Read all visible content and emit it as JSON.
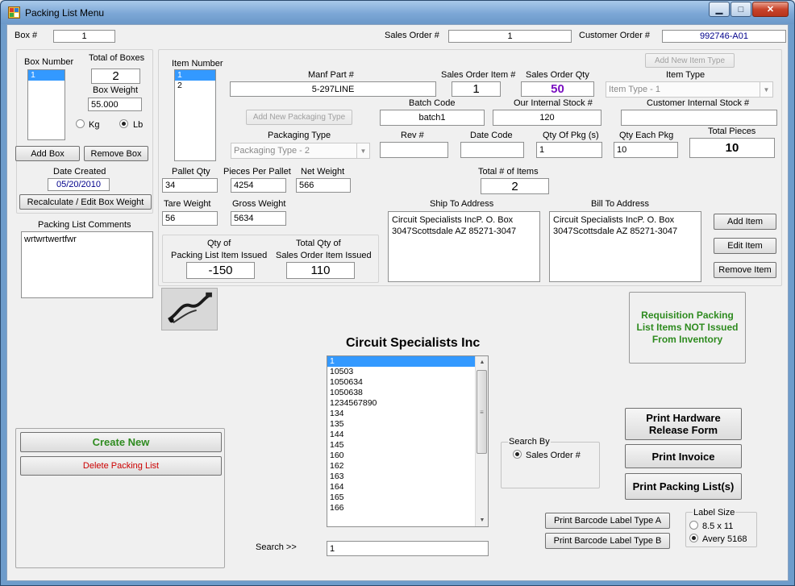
{
  "window": {
    "title": "Packing List Menu",
    "min_glyph": "▁",
    "max_glyph": "□",
    "close_glyph": "✕"
  },
  "header": {
    "box_label": "Box #",
    "box_value": "1",
    "sales_order_label": "Sales Order #",
    "sales_order_value": "1",
    "customer_order_label": "Customer Order #",
    "customer_order_value": "992746-A01"
  },
  "box_panel": {
    "box_number_label": "Box Number",
    "box_numbers": [
      "1"
    ],
    "total_boxes_label": "Total of Boxes",
    "total_boxes_value": "2",
    "box_weight_label": "Box Weight",
    "box_weight_value": "55.000",
    "kg_label": "Kg",
    "lb_label": "Lb",
    "unit_selected": "Lb",
    "add_box": "Add Box",
    "remove_box": "Remove Box",
    "date_created_label": "Date Created",
    "date_created_value": "05/20/2010",
    "recalc_button": "Recalculate / Edit Box Weight"
  },
  "comments": {
    "label": "Packing List Comments",
    "value": "wrtwrtwertfwr"
  },
  "item_panel": {
    "item_number_label": "Item Number",
    "item_numbers": [
      "1",
      "2"
    ],
    "manf_part_label": "Manf Part #",
    "manf_part_value": "5-297LINE",
    "so_item_label": "Sales Order Item #",
    "so_item_value": "1",
    "so_qty_label": "Sales Order Qty",
    "so_qty_value": "50",
    "add_item_type": "Add New Item Type",
    "item_type_label": "Item Type",
    "item_type_value": "Item Type - 1",
    "add_packaging_type": "Add New Packaging Type",
    "batch_code_label": "Batch Code",
    "batch_code_value": "batch1",
    "internal_stock_label": "Our Internal Stock #",
    "internal_stock_value": "120",
    "cust_stock_label": "Customer Internal Stock #",
    "cust_stock_value": "",
    "packaging_type_label": "Packaging Type",
    "packaging_type_value": "Packaging Type - 2",
    "rev_label": "Rev #",
    "rev_value": "",
    "date_code_label": "Date Code",
    "date_code_value": "",
    "qty_pkgs_label": "Qty Of Pkg (s)",
    "qty_pkgs_value": "1",
    "qty_each_label": "Qty Each Pkg",
    "qty_each_value": "10",
    "total_pieces_label": "Total Pieces",
    "total_pieces_value": "10",
    "pallet_qty_label": "Pallet Qty",
    "pallet_qty_value": "34",
    "pieces_pallet_label": "Pieces Per Pallet",
    "pieces_pallet_value": "4254",
    "net_weight_label": "Net Weight",
    "net_weight_value": "566",
    "total_items_label": "Total # of Items",
    "total_items_value": "2",
    "tare_label": "Tare Weight",
    "tare_value": "56",
    "gross_label": "Gross Weight",
    "gross_value": "5634",
    "ship_to_label": "Ship To Address",
    "ship_to_line1": "Circuit Specialists IncP. O. Box",
    "ship_to_line2": "3047Scottsdale AZ 85271-3047",
    "bill_to_label": "Bill To Address",
    "bill_to_line1": "Circuit Specialists IncP. O. Box",
    "bill_to_line2": "3047Scottsdale AZ 85271-3047",
    "qty_issued_label1": "Qty of",
    "qty_issued_label2": "Packing List Item Issued",
    "qty_issued_value": "-150",
    "total_issued_label1": "Total Qty of",
    "total_issued_label2": "Sales Order Item Issued",
    "total_issued_value": "110",
    "add_item": "Add Item",
    "edit_item": "Edit Item",
    "remove_item": "Remove Item"
  },
  "requisition_text": "Requisition Packing List Items NOT Issued From Inventory",
  "customer_name": "Circuit Specialists Inc",
  "orders_list": [
    "1",
    "10503",
    "1050634",
    "1050638",
    "1234567890",
    "134",
    "135",
    "144",
    "145",
    "160",
    "162",
    "163",
    "164",
    "165",
    "166"
  ],
  "search": {
    "label": "Search >>",
    "value": "1",
    "search_by_label": "Search By",
    "search_by_option": "Sales Order #"
  },
  "actions": {
    "create_new": "Create New",
    "delete_packing_list": "Delete Packing List",
    "print_hardware_line1": "Print Hardware",
    "print_hardware_line2": "Release Form",
    "print_invoice": "Print Invoice",
    "print_packing_lists": "Print Packing List(s)",
    "print_barcode_a": "Print Barcode Label Type A",
    "print_barcode_b": "Print Barcode Label Type B"
  },
  "label_size": {
    "label": "Label Size",
    "opt1": "8.5 x 11",
    "opt2": "Avery 5168",
    "selected": "Avery 5168"
  },
  "colors": {
    "green": "#2e8b1f",
    "red": "#cc0000",
    "purple": "#7a10c0",
    "navy": "#00008b",
    "selection": "#3399ff"
  }
}
